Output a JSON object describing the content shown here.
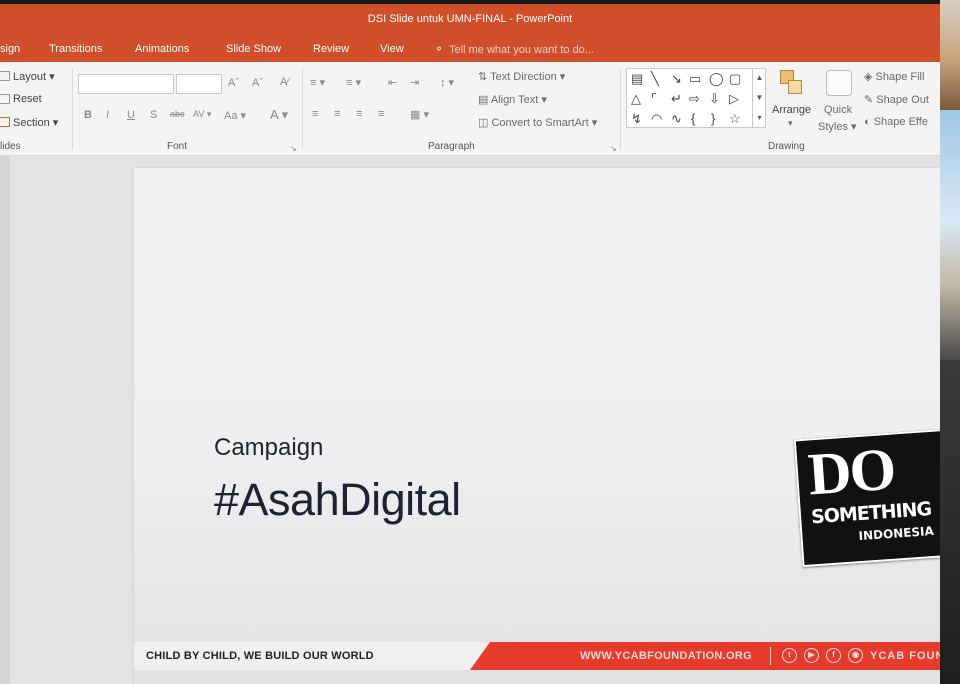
{
  "window": {
    "title": "DSI Slide untuk UMN-FINAL - PowerPoint"
  },
  "tabs": [
    "sign",
    "Transitions",
    "Animations",
    "Slide Show",
    "Review",
    "View"
  ],
  "tell_me": "Tell me what you want to do...",
  "ribbon": {
    "slides": {
      "layout": "Layout",
      "reset": "Reset",
      "section": "Section",
      "label": "lides"
    },
    "font": {
      "label": "Font",
      "aa": "Aa"
    },
    "paragraph": {
      "label": "Paragraph",
      "text_direction": "Text Direction",
      "align_text": "Align Text",
      "convert_smartart": "Convert to SmartArt"
    },
    "drawing": {
      "label": "Drawing",
      "arrange": "Arrange",
      "quick": "Quick",
      "styles": "Styles",
      "shape_fill": "Shape Fill",
      "shape_outline": "Shape Out",
      "shape_effects": "Shape Effe"
    }
  },
  "slide": {
    "subtitle": "Campaign",
    "title": "#AsahDigital",
    "footer_tagline": "CHILD BY CHILD, WE BUILD OUR WORLD",
    "footer_url": "WWW.YCABFOUNDATION.ORG",
    "footer_org": "YCAB FOUN",
    "logo": {
      "line1": "DO",
      "line2": "SOMETHING",
      "line3": "INDONESIA"
    }
  },
  "colors": {
    "accent": "#d04f2a",
    "footer_red": "#e53b2c",
    "text_dark": "#1f2233"
  }
}
